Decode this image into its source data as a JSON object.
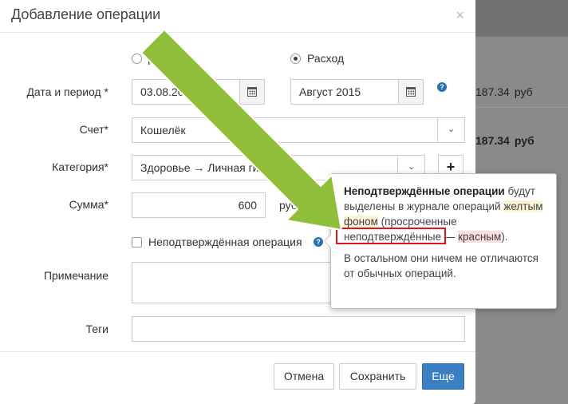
{
  "background": {
    "amounts": [
      {
        "value": "187.34",
        "currency": "руб",
        "bold": false
      },
      {
        "value": "187.34",
        "currency": "руб",
        "bold": true
      }
    ]
  },
  "modal": {
    "title": "Добавление операции",
    "close_symbol": "×",
    "radio_income_label": "Дох",
    "radio_expense_label": "Расход",
    "date_label": "Дата и период *",
    "date_value": "03.08.2015",
    "period_value": "Август 2015",
    "account_label": "Счет*",
    "account_value": "Кошелёк",
    "category_label": "Категория*",
    "category_value": "Здоровье → Личная гиги",
    "plus_symbol": "+",
    "amount_label": "Сумма*",
    "amount_value": "600",
    "currency_value": "руб",
    "unconfirmed_label": "Неподтверждённая операция",
    "note_label": "Примечание",
    "tags_label": "Теги",
    "help_symbol": "?",
    "buttons": {
      "cancel": "Отмена",
      "save": "Сохранить",
      "more": "Еще"
    }
  },
  "popover": {
    "title": "Неподтверждённые операции",
    "text_1": "будут выделены в журнале операций",
    "text_yellow": "желтым фоном",
    "text_2": "(просроченные неподтверждённые —",
    "text_red": "красным",
    "text_3": ").",
    "text_para2": "В остальном они ничем не отличаются от обычных операций."
  },
  "colors": {
    "primary": "#3a7fc1",
    "arrow": "#8fbe3a",
    "highlight_box": "#e0141e"
  }
}
